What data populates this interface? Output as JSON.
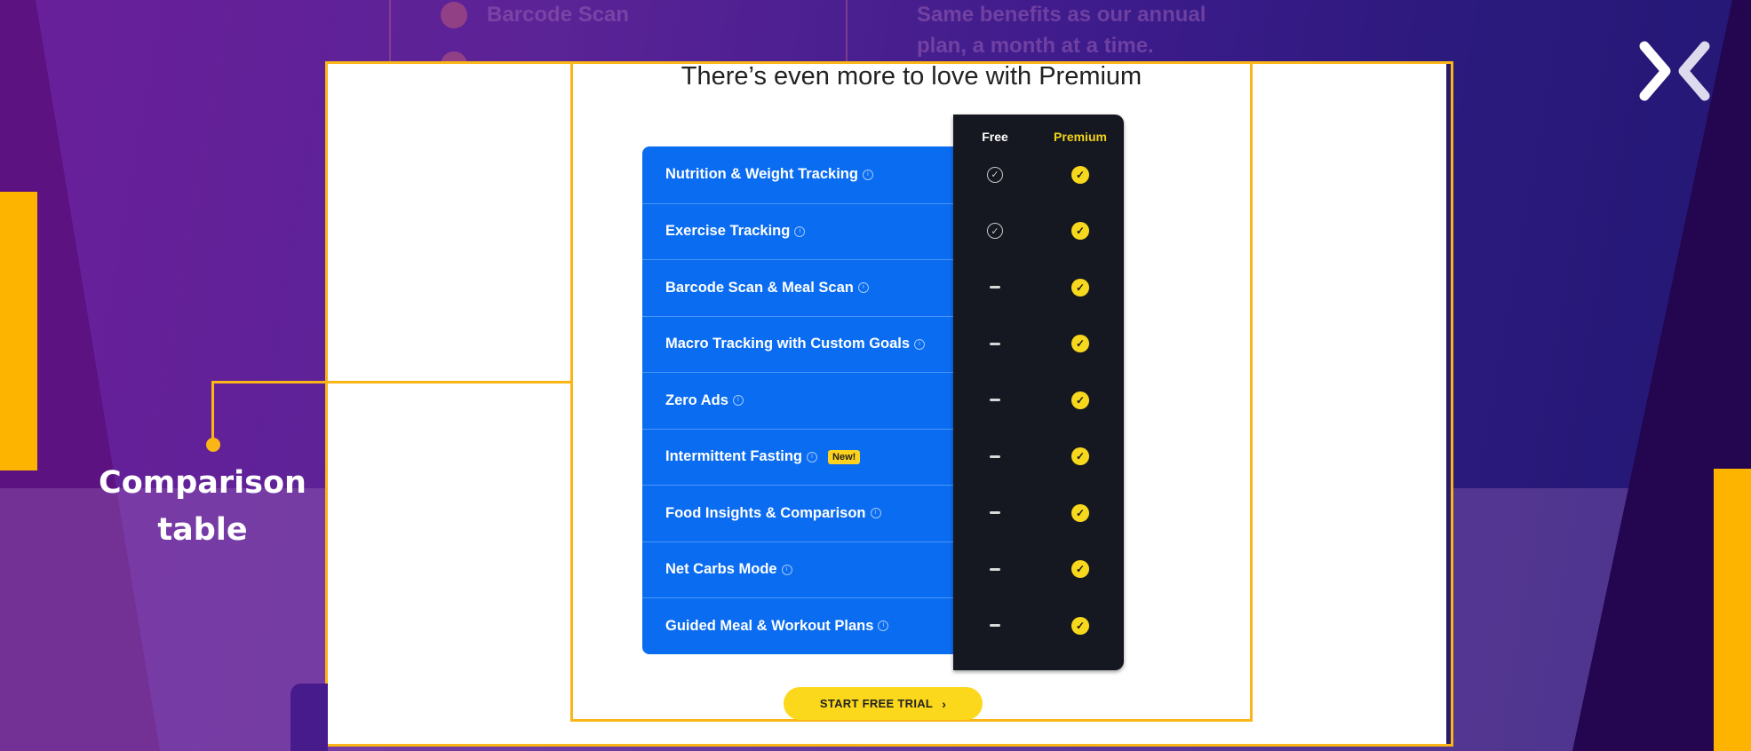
{
  "background": {
    "faded_items": [
      "Barcode Scan"
    ],
    "faded_description": [
      "Same benefits as our annual",
      "plan, a month at a time."
    ]
  },
  "callout": {
    "label_line1": "Comparison",
    "label_line2": "table"
  },
  "comparison": {
    "title": "There’s even more to love with Premium",
    "columns": {
      "free": "Free",
      "premium": "Premium"
    },
    "features": [
      {
        "name": "Nutrition & Weight Tracking",
        "badge": null,
        "free": "check",
        "premium": "check"
      },
      {
        "name": "Exercise Tracking",
        "badge": null,
        "free": "check",
        "premium": "check"
      },
      {
        "name": "Barcode Scan & Meal Scan",
        "badge": null,
        "free": "none",
        "premium": "check"
      },
      {
        "name": "Macro Tracking with Custom Goals",
        "badge": null,
        "free": "none",
        "premium": "check"
      },
      {
        "name": "Zero Ads",
        "badge": null,
        "free": "none",
        "premium": "check"
      },
      {
        "name": "Intermittent Fasting",
        "badge": "New!",
        "free": "none",
        "premium": "check"
      },
      {
        "name": "Food Insights & Comparison",
        "badge": null,
        "free": "none",
        "premium": "check"
      },
      {
        "name": "Net Carbs Mode",
        "badge": null,
        "free": "none",
        "premium": "check"
      },
      {
        "name": "Guided Meal & Workout Plans",
        "badge": null,
        "free": "none",
        "premium": "check"
      }
    ],
    "cta_label": "START FREE TRIAL",
    "cta_icon": "chevron-right-icon"
  },
  "icons": {
    "info": "ⓘ",
    "check": "✓",
    "chevron": "›"
  },
  "colors": {
    "accent_yellow": "#fbb516",
    "table_blue": "#0a6cf0",
    "panel_dark": "#161821",
    "premium_yellow": "#f8d81c"
  }
}
